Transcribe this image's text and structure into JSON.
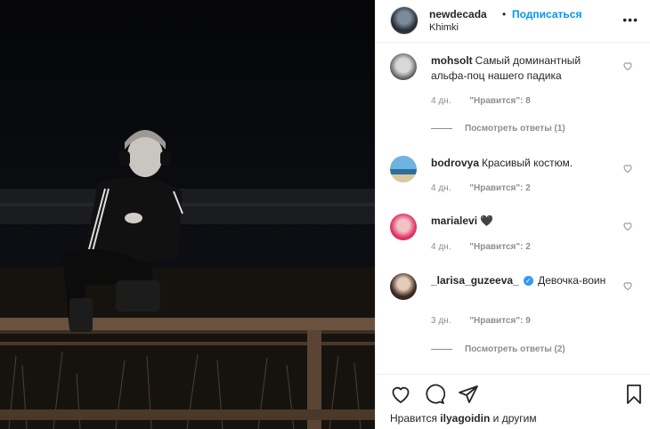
{
  "header": {
    "username": "newdecada",
    "separator": "•",
    "follow_label": "Подписаться",
    "location": "Khimki",
    "more_label": "•••"
  },
  "comments": [
    {
      "username": "mohsolt",
      "text": "Самый доминантный альфа-поц нашего падика",
      "time": "4 дн.",
      "likes": "\"Нравится\": 8",
      "replies": "Посмотреть ответы (1)"
    },
    {
      "username": "bodrovya",
      "text": "Красивый костюм.",
      "time": "4 дн.",
      "likes": "\"Нравится\": 2"
    },
    {
      "username": "marialevi",
      "text": "🖤",
      "time": "4 дн.",
      "likes": "\"Нравится\": 2"
    },
    {
      "username": "_larisa_guzeeva_",
      "verified_mark": "✓",
      "text": "Девочка-воин",
      "time": "3 дн.",
      "likes": "\"Нравится\": 9",
      "replies": "Посмотреть ответы (2)"
    }
  ],
  "footer": {
    "likes_prefix": "Нравится",
    "liked_by": "ilyagoidin",
    "likes_suffix": "и другим"
  },
  "icons": [
    "heart-icon",
    "comment-icon",
    "share-icon",
    "bookmark-icon",
    "more-icon",
    "verified-icon"
  ],
  "colors": {
    "accent": "#0095f6",
    "text": "#262626",
    "muted": "#8e8e8e",
    "verified": "#3897f0"
  }
}
